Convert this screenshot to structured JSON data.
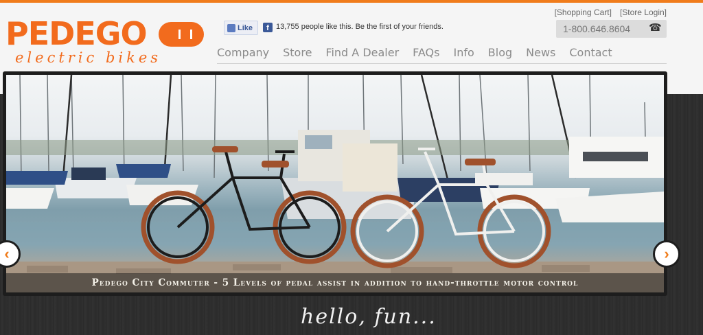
{
  "brand": {
    "name": "PEDEGO",
    "tagline": "electric bikes"
  },
  "facebook": {
    "like_label": "Like",
    "count_text": "13,755 people like this. Be the first of your friends."
  },
  "toplinks": [
    {
      "label": "[Shopping Cart]"
    },
    {
      "label": "[Store Login]"
    }
  ],
  "phone": {
    "number": "1-800.646.8604",
    "icon": "phone-icon"
  },
  "nav": {
    "items": [
      "Company",
      "Store",
      "Find A Dealer",
      "FAQs",
      "Info",
      "Blog",
      "News",
      "Contact"
    ]
  },
  "slider": {
    "caption": "Pedego City Commuter - 5 Levels of pedal assist in addition to hand-throttle motor control",
    "prev_icon": "chevron-left-icon",
    "next_icon": "chevron-right-icon"
  },
  "footer_tagline": "hello, fun...",
  "colors": {
    "accent": "#f07c1b",
    "brand_orange": "#f26b1d",
    "dark_bg": "#2c2c2c",
    "facebook": "#3b5998"
  }
}
